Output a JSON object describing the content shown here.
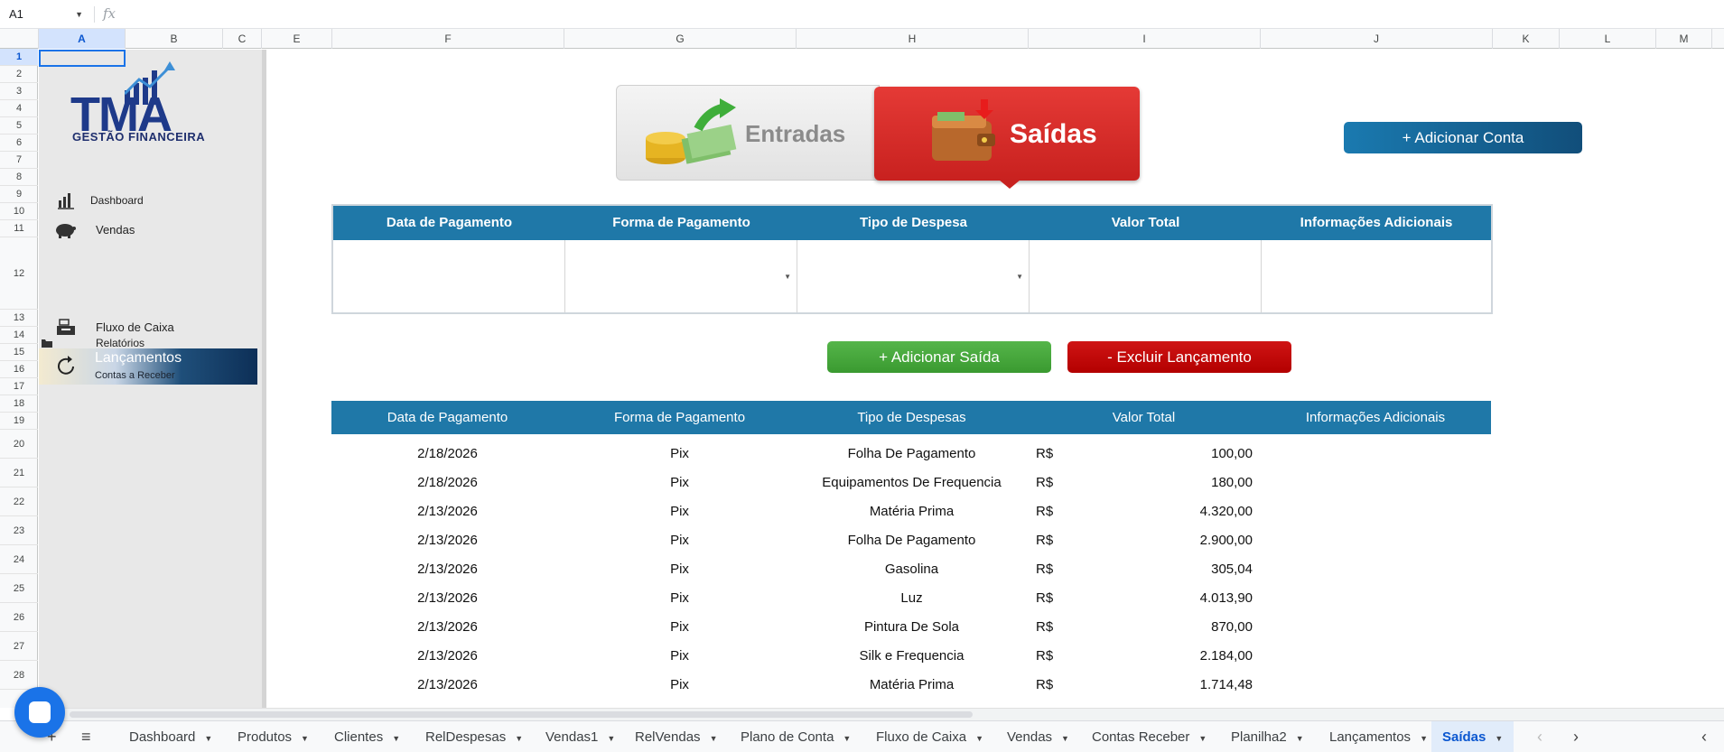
{
  "formula_bar": {
    "cell_ref": "A1",
    "fx": "fx"
  },
  "columns": [
    "A",
    "B",
    "C",
    "E",
    "F",
    "G",
    "H",
    "I",
    "J",
    "K",
    "L",
    "M"
  ],
  "rows": [
    "1",
    "2",
    "3",
    "4",
    "5",
    "6",
    "7",
    "8",
    "9",
    "10",
    "11",
    "12",
    "13",
    "14",
    "15",
    "16",
    "17",
    "18",
    "19",
    "20",
    "21",
    "22",
    "23",
    "24",
    "25",
    "26",
    "27",
    "28"
  ],
  "logo": {
    "text": "TMA",
    "subtitle": "GESTÃO FINANCEIRA"
  },
  "sidebar": {
    "dashboard": "Dashboard",
    "vendas": "Vendas",
    "fluxo": "Fluxo de Caixa",
    "relatorios": "Relatórios",
    "lancamentos": "Lançamentos",
    "contas_receber": "Contas a Receber"
  },
  "toggle": {
    "entradas": "Entradas",
    "saidas": "Saídas"
  },
  "buttons": {
    "adicionar_conta": "+ Adicionar Conta",
    "adicionar_saida": "+ Adicionar Saída",
    "excluir": "- Excluir Lançamento"
  },
  "form": {
    "headers": [
      "Data de Pagamento",
      "Forma de Pagamento",
      "Tipo de Despesa",
      "Valor Total",
      "Informações Adicionais"
    ]
  },
  "table": {
    "headers": [
      "Data de Pagamento",
      "Forma de Pagamento",
      "Tipo de Despesas",
      "Valor Total",
      "Informações Adicionais"
    ],
    "currency": "R$",
    "rows": [
      {
        "date": "2/18/2026",
        "forma": "Pix",
        "tipo": "Folha De Pagamento",
        "valor": "100,00"
      },
      {
        "date": "2/18/2026",
        "forma": "Pix",
        "tipo": "Equipamentos De Frequencia",
        "valor": "180,00"
      },
      {
        "date": "2/13/2026",
        "forma": "Pix",
        "tipo": "Matéria Prima",
        "valor": "4.320,00"
      },
      {
        "date": "2/13/2026",
        "forma": "Pix",
        "tipo": "Folha De Pagamento",
        "valor": "2.900,00"
      },
      {
        "date": "2/13/2026",
        "forma": "Pix",
        "tipo": "Gasolina",
        "valor": "305,04"
      },
      {
        "date": "2/13/2026",
        "forma": "Pix",
        "tipo": "Luz",
        "valor": "4.013,90"
      },
      {
        "date": "2/13/2026",
        "forma": "Pix",
        "tipo": "Pintura De Sola",
        "valor": "870,00"
      },
      {
        "date": "2/13/2026",
        "forma": "Pix",
        "tipo": "Silk e Frequencia",
        "valor": "2.184,00"
      },
      {
        "date": "2/13/2026",
        "forma": "Pix",
        "tipo": "Matéria Prima",
        "valor": "1.714,48"
      }
    ]
  },
  "tabs": [
    "Dashboard",
    "Produtos",
    "Clientes",
    "RelDespesas",
    "Vendas1",
    "RelVendas",
    "Plano de Conta",
    "Fluxo de Caixa",
    "Vendas",
    "Contas Receber",
    "Planilha2",
    "Lançamentos",
    "Saídas"
  ],
  "active_tab": "Saídas",
  "colors": {
    "header_blue": "#1f78a8",
    "saidas_red": "#d82b28",
    "add_green": "#4aab3f",
    "delete_red": "#c20a0a",
    "accent_blue": "#1a73e8"
  }
}
